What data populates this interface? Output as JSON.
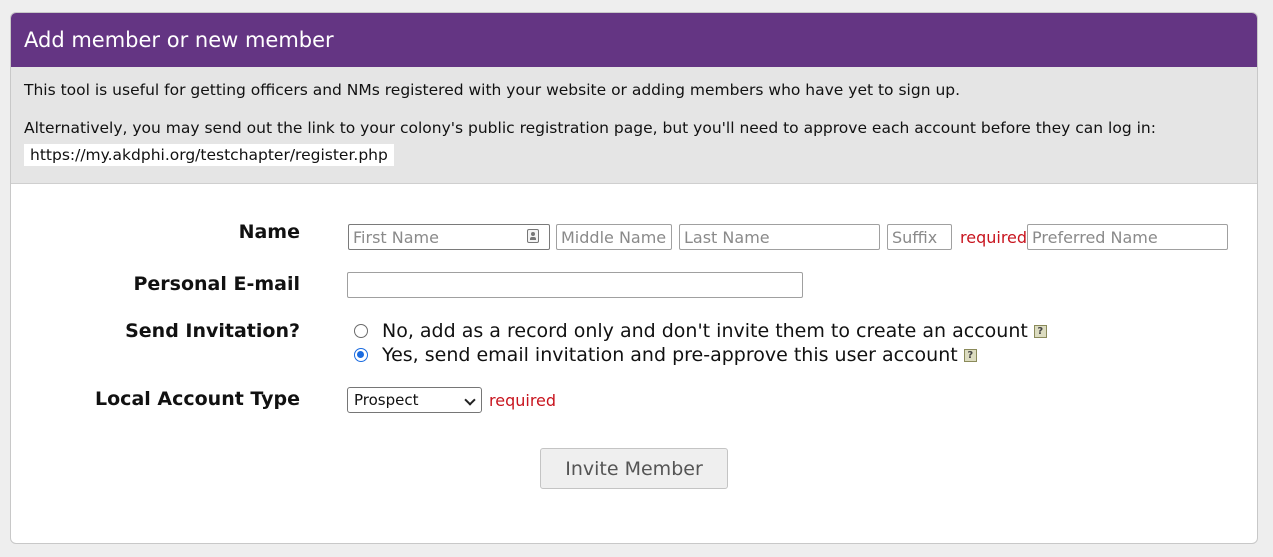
{
  "header": {
    "title": "Add member or new member"
  },
  "intro": {
    "line1": "This tool is useful for getting officers and NMs registered with your website or adding members who have yet to sign up.",
    "line2": "Alternatively, you may send out the link to your colony's public registration page, but you'll need to approve each account before they can log in:",
    "link": "https://my.akdphi.org/testchapter/register.php"
  },
  "form": {
    "name": {
      "label": "Name",
      "first_placeholder": "First Name",
      "middle_placeholder": "Middle Name",
      "last_placeholder": "Last Name",
      "suffix_placeholder": "Suffix",
      "required": "required",
      "preferred_placeholder": "Preferred Name"
    },
    "email": {
      "label": "Personal E-mail",
      "value": ""
    },
    "invitation": {
      "label": "Send Invitation?",
      "options": [
        {
          "label": "No, add as a record only and don't invite them to create an account",
          "checked": false
        },
        {
          "label": "Yes, send email invitation and pre-approve this user account",
          "checked": true
        }
      ],
      "help_glyph": "?"
    },
    "account_type": {
      "label": "Local Account Type",
      "selected": "Prospect",
      "required": "required"
    },
    "submit_label": "Invite Member"
  },
  "colors": {
    "header_bg": "#643583",
    "required": "#c8141e",
    "radio_accent": "#1a6be0"
  },
  "icons": [
    "contact-card-icon",
    "help-icon",
    "chevron-down-icon"
  ]
}
